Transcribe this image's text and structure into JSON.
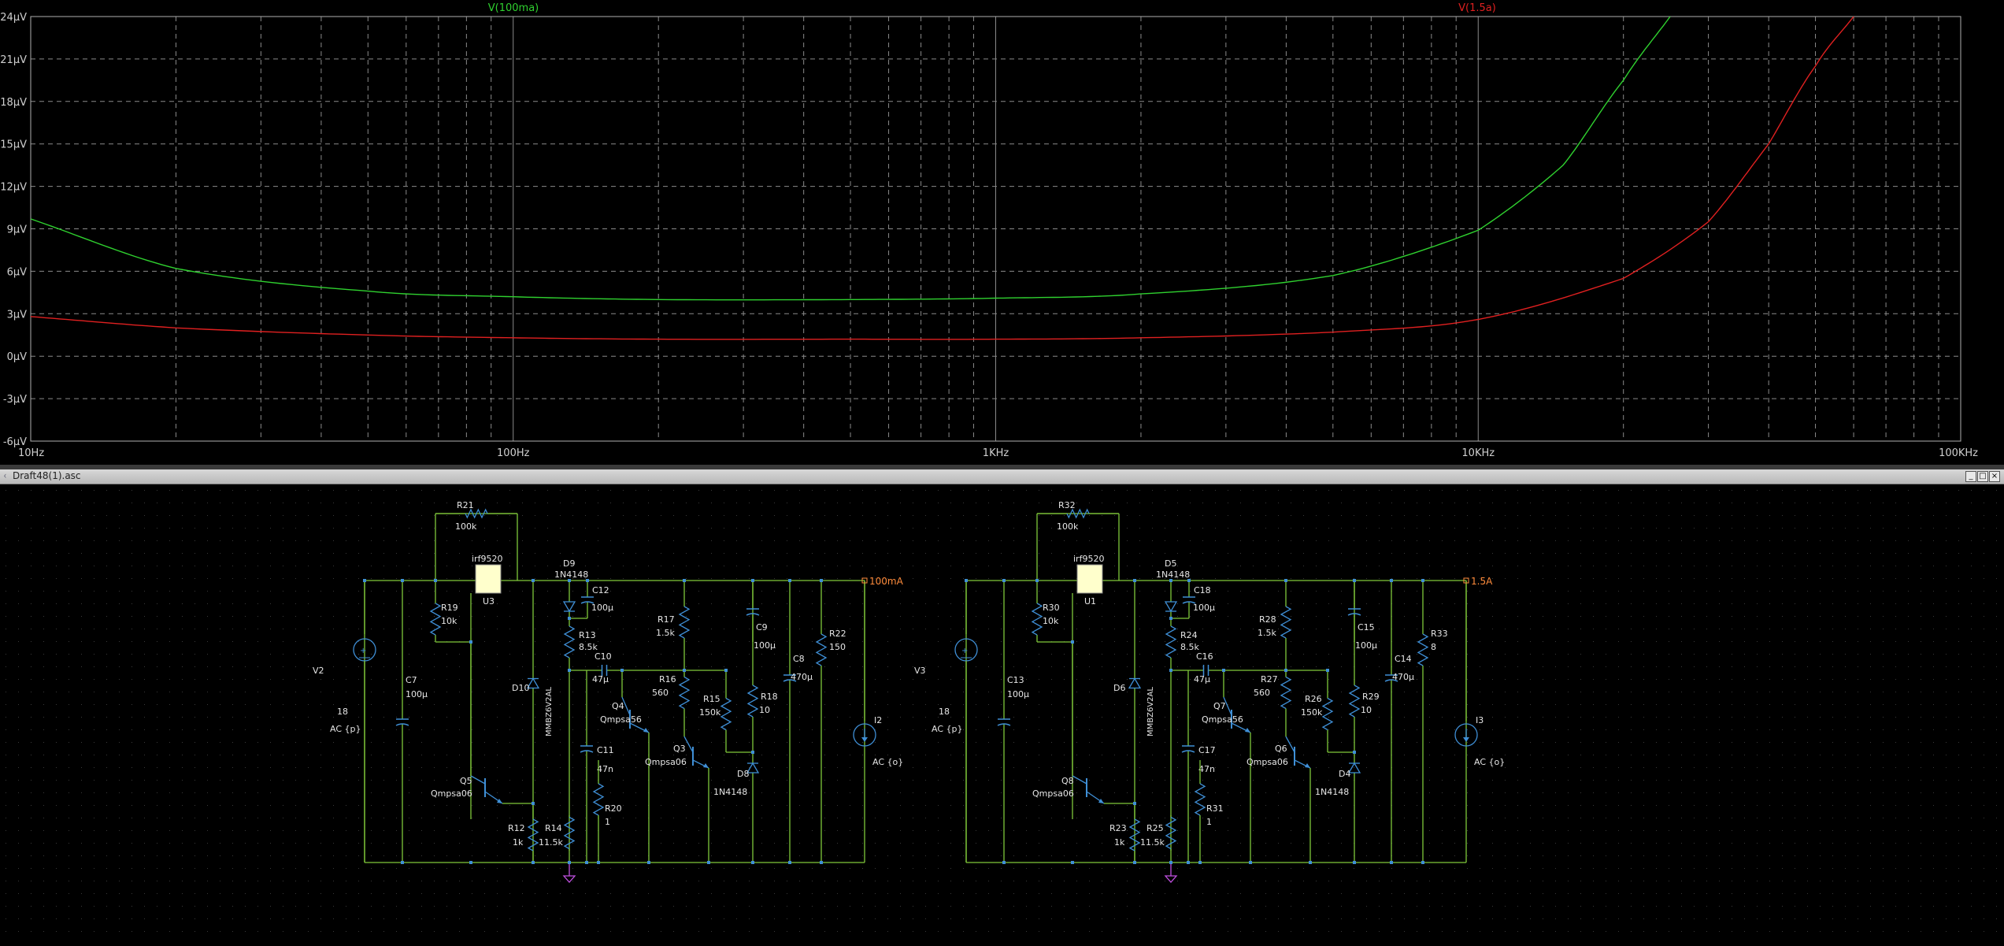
{
  "plot": {
    "background": "#000000",
    "grid_color": "#8a8a8a",
    "label_color": "#cfcfcf",
    "traces": [
      {
        "name": "V(100ma)",
        "color": "#2fd12f"
      },
      {
        "name": "V(1.5a)",
        "color": "#e02020"
      }
    ],
    "y_ticks": [
      "24µV",
      "21µV",
      "18µV",
      "15µV",
      "12µV",
      "9µV",
      "6µV",
      "3µV",
      "0µV",
      "-3µV",
      "-6µV"
    ],
    "x_ticks": [
      "10Hz",
      "100Hz",
      "1KHz",
      "10KHz",
      "100KHz"
    ]
  },
  "chart_data": {
    "type": "line",
    "x_scale": "log",
    "xlim": [
      10,
      100000
    ],
    "ylim": [
      -6,
      24
    ],
    "xlabel": "",
    "ylabel": "",
    "grid": true,
    "series": [
      {
        "name": "V(100ma)",
        "color": "#2fd12f",
        "x": [
          10,
          20,
          50,
          100,
          200,
          500,
          1000,
          2000,
          5000,
          10000,
          15000,
          20000,
          25000
        ],
        "y": [
          9.7,
          6.2,
          4.6,
          4.2,
          4.0,
          4.0,
          4.1,
          4.4,
          5.7,
          8.9,
          13.5,
          19.5,
          24
        ]
      },
      {
        "name": "V(1.5a)",
        "color": "#e02020",
        "x": [
          10,
          20,
          50,
          100,
          200,
          500,
          1000,
          2000,
          5000,
          10000,
          20000,
          30000,
          40000,
          50000,
          60000
        ],
        "y": [
          2.8,
          2.0,
          1.5,
          1.3,
          1.2,
          1.2,
          1.2,
          1.3,
          1.7,
          2.6,
          5.5,
          9.5,
          15.0,
          20.5,
          24
        ]
      }
    ]
  },
  "window": {
    "title": "Draft48(1).asc",
    "minimize": "_",
    "restore": "□",
    "close": "×"
  },
  "schematic": {
    "background": "#000000",
    "wire_color": "#7fc83a",
    "part_color": "#3f8fd6",
    "text_color": "#e6e6e6",
    "net_color": "#ff8c3c",
    "circuit1": {
      "out_net": "100mA",
      "labels": {
        "R21": "R21",
        "R21v": "100k",
        "U3t": "irf9520",
        "U3": "U3",
        "D9": "D9",
        "D9v": "1N4148",
        "C12": "C12",
        "C12v": "100µ",
        "R19": "R19",
        "R19v": "10k",
        "V2": "V2",
        "V2v": "18",
        "V2ac": "AC {p}",
        "C7": "C7",
        "C7v": "100µ",
        "R13": "R13",
        "R13v": "8.5k",
        "C10": "C10",
        "C10v": "47µ",
        "D10": "D10",
        "D10p": "MMBZ6V2AL",
        "R17": "R17",
        "R17v": "1.5k",
        "C9": "C9",
        "C9v": "100µ",
        "C8": "C8",
        "C8v": "470µ",
        "R22": "R22",
        "R22v": "150",
        "R16": "R16",
        "R16v": "560",
        "Q4": "Q4",
        "Q4v": "Qmpsa56",
        "R15": "R15",
        "R15v": "150k",
        "R18": "R18",
        "R18v": "10",
        "I2": "I2",
        "I2ac": "AC {o}",
        "C11": "C11",
        "C11v": "47n",
        "Q3": "Q3",
        "Q3v": "Qmpsa06",
        "D8": "D8",
        "D8v": "1N4148",
        "Q5": "Q5",
        "Q5v": "Qmpsa06",
        "R20": "R20",
        "R20v": "1",
        "R12": "R12",
        "R12v": "1k",
        "R14": "R14",
        "R14v": "11.5k"
      }
    },
    "circuit2": {
      "out_net": "1.5A",
      "labels": {
        "R21": "R32",
        "R21v": "100k",
        "U3t": "irf9520",
        "U3": "U1",
        "D9": "D5",
        "D9v": "1N4148",
        "C12": "C18",
        "C12v": "100µ",
        "R19": "R30",
        "R19v": "10k",
        "V2": "V3",
        "V2v": "18",
        "V2ac": "AC {p}",
        "C7": "C13",
        "C7v": "100µ",
        "R13": "R24",
        "R13v": "8.5k",
        "C10": "C16",
        "C10v": "47µ",
        "D10": "D6",
        "D10p": "MMBZ6V2AL",
        "R17": "R28",
        "R17v": "1.5k",
        "C9": "C15",
        "C9v": "100µ",
        "C8": "C14",
        "C8v": "470µ",
        "R22": "R33",
        "R22v": "8",
        "R16": "R27",
        "R16v": "560",
        "Q4": "Q7",
        "Q4v": "Qmpsa56",
        "R15": "R26",
        "R15v": "150k",
        "R18": "R29",
        "R18v": "10",
        "I2": "I3",
        "I2ac": "AC {o}",
        "C11": "C17",
        "C11v": "47n",
        "Q3": "Q6",
        "Q3v": "Qmpsa06",
        "D8": "D4",
        "D8v": "1N4148",
        "Q5": "Q8",
        "Q5v": "Qmpsa06",
        "R20": "R31",
        "R20v": "1",
        "R12": "R23",
        "R12v": "1k",
        "R14": "R25",
        "R14v": "11.5k"
      }
    }
  }
}
